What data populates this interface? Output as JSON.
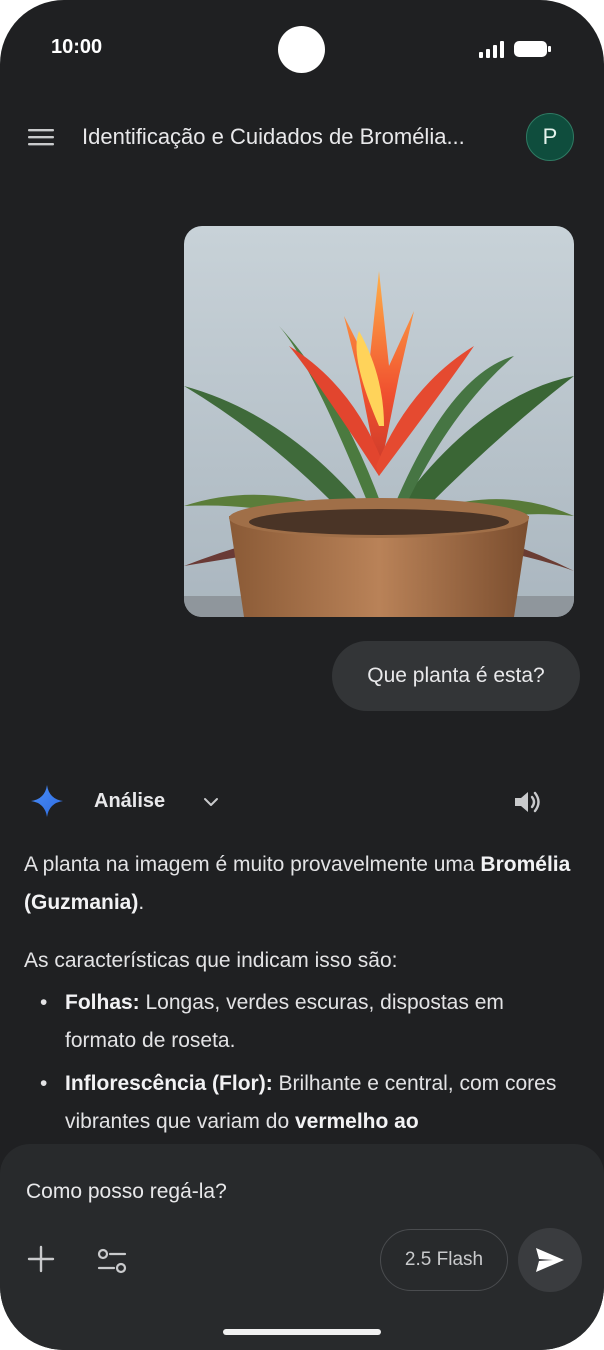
{
  "status_bar": {
    "time": "10:00"
  },
  "header": {
    "title": "Identificação e Cuidados de Bromélia...",
    "avatar_letter": "P"
  },
  "conversation": {
    "user_image": {
      "icon": "bromeliad-plant-photo"
    },
    "user_message": "Que planta é esta?"
  },
  "response": {
    "mode_label": "Análise",
    "intro_text": "A planta na imagem é muito provavelmente uma ",
    "intro_bold": "Bromélia (Guzmania)",
    "intro_end": ".",
    "characteristics_intro": "As características que indicam isso são:",
    "bullets": [
      {
        "bold": "Folhas:",
        "text": " Longas, verdes escuras, dispostas em formato de roseta."
      },
      {
        "bold": "Inflorescência (Flor):",
        "text": " Brilhante e central, com cores vibrantes que variam do ",
        "bold_end": "vermelho ao"
      }
    ]
  },
  "input": {
    "value": "Como posso regá-la?",
    "model_label": "2.5 Flash"
  },
  "colors": {
    "background": "#1f2022",
    "panel": "#282a2c",
    "bubble": "#333537",
    "accent": "#4a8df8",
    "avatar": "#0f4d3d"
  }
}
